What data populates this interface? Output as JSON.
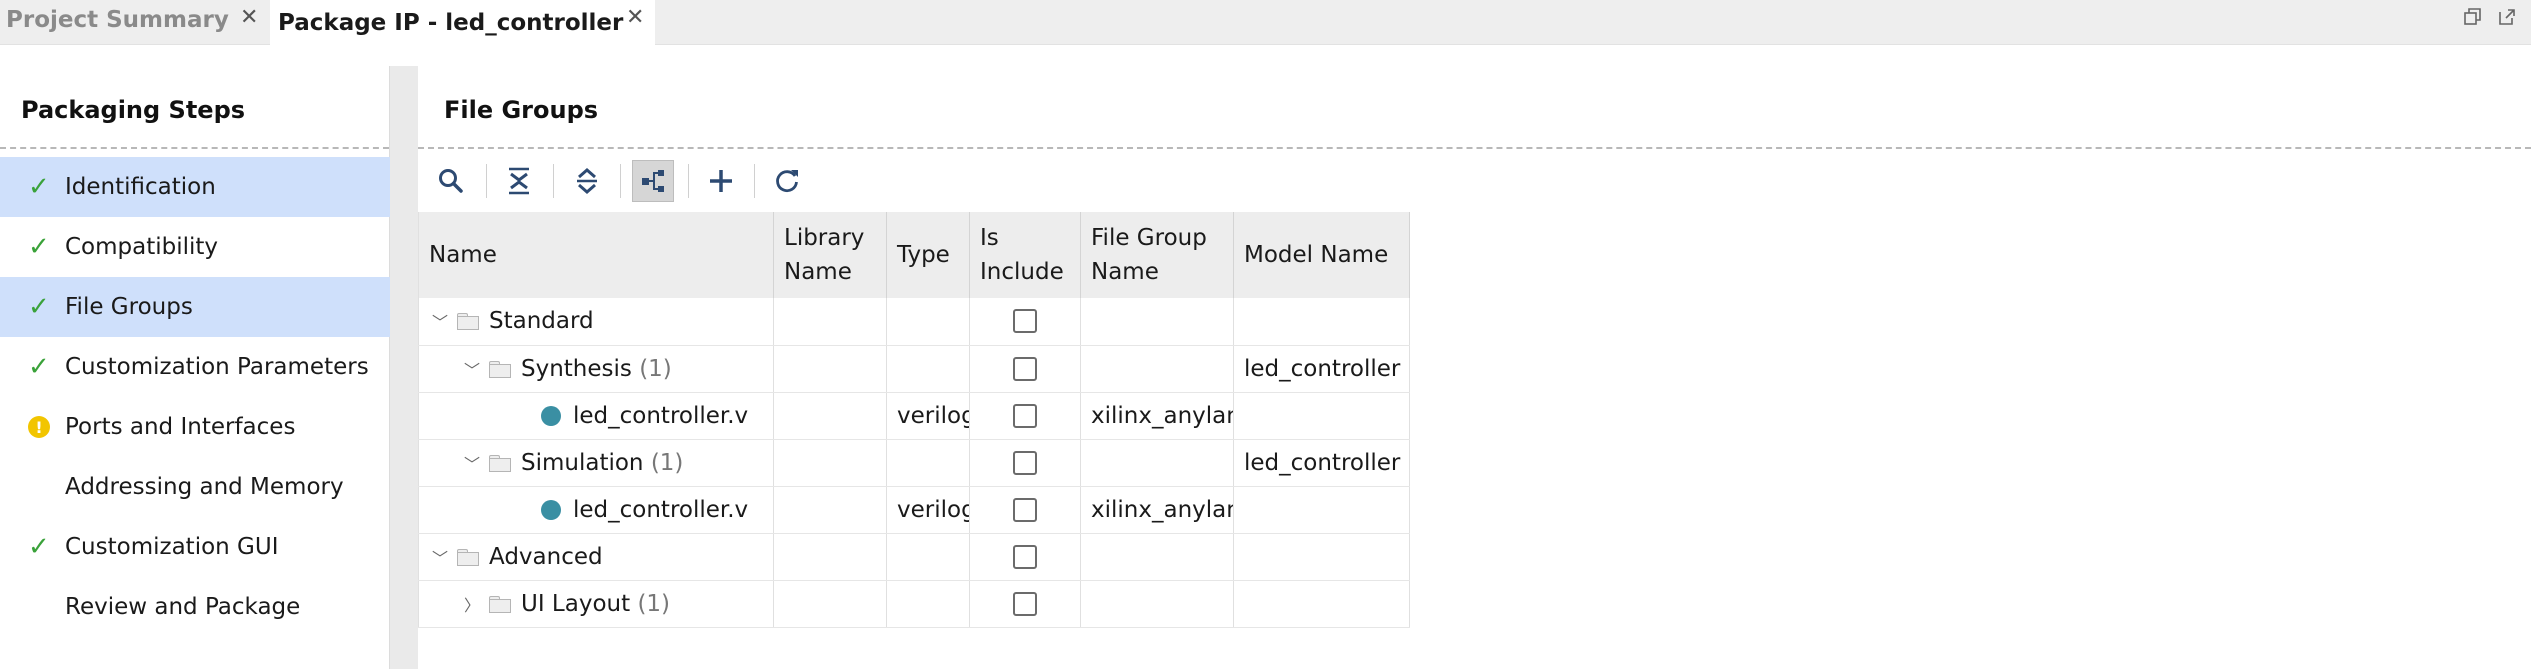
{
  "tabs": [
    {
      "label": "Project Summary",
      "active": false
    },
    {
      "label": "Package IP - led_controller",
      "active": true
    }
  ],
  "left_panel": {
    "title": "Packaging Steps",
    "steps": [
      {
        "label": "Identification",
        "status": "check",
        "selected": true
      },
      {
        "label": "Compatibility",
        "status": "check",
        "selected": false
      },
      {
        "label": "File Groups",
        "status": "check",
        "selected": true
      },
      {
        "label": "Customization Parameters",
        "status": "check",
        "selected": false
      },
      {
        "label": "Ports and Interfaces",
        "status": "warning",
        "selected": false
      },
      {
        "label": "Addressing and Memory",
        "status": "none",
        "selected": false
      },
      {
        "label": "Customization GUI",
        "status": "check",
        "selected": false
      },
      {
        "label": "Review and Package",
        "status": "none",
        "selected": false
      }
    ]
  },
  "right_panel": {
    "title": "File Groups",
    "toolbar": [
      "search-icon",
      "collapse-all-icon",
      "expand-all-icon",
      "hierarchy-icon",
      "add-icon",
      "refresh-icon"
    ],
    "columns": {
      "name": "Name",
      "library_name": "Library Name",
      "type": "Type",
      "is_include": "Is Include",
      "file_group_name": "File Group Name",
      "model_name": "Model Name"
    },
    "rows": [
      {
        "name": "Standard",
        "count": "",
        "library": "",
        "type": "",
        "include": false,
        "file_group": "",
        "model": ""
      },
      {
        "name": "Synthesis",
        "count": "(1)",
        "library": "",
        "type": "",
        "include": false,
        "file_group": "",
        "model": "led_controller"
      },
      {
        "name": "led_controller.v",
        "count": "",
        "library": "",
        "type": "verilog",
        "include": false,
        "file_group": "xilinx_anylanguagesynthesis",
        "model": ""
      },
      {
        "name": "Simulation",
        "count": "(1)",
        "library": "",
        "type": "",
        "include": false,
        "file_group": "",
        "model": "led_controller"
      },
      {
        "name": "led_controller.v",
        "count": "",
        "library": "",
        "type": "verilog",
        "include": false,
        "file_group": "xilinx_anylanguagebehavioralsimulation",
        "model": ""
      },
      {
        "name": "Advanced",
        "count": "",
        "library": "",
        "type": "",
        "include": false,
        "file_group": "",
        "model": ""
      },
      {
        "name": "UI Layout",
        "count": "(1)",
        "library": "",
        "type": "",
        "include": false,
        "file_group": "",
        "model": ""
      }
    ]
  },
  "colors": {
    "selected_row": "#cfe0fb",
    "check": "#3aa23a",
    "warning": "#f2c500",
    "file_dot": "#3a8fa3",
    "toolbar_icon": "#2d4a72"
  }
}
